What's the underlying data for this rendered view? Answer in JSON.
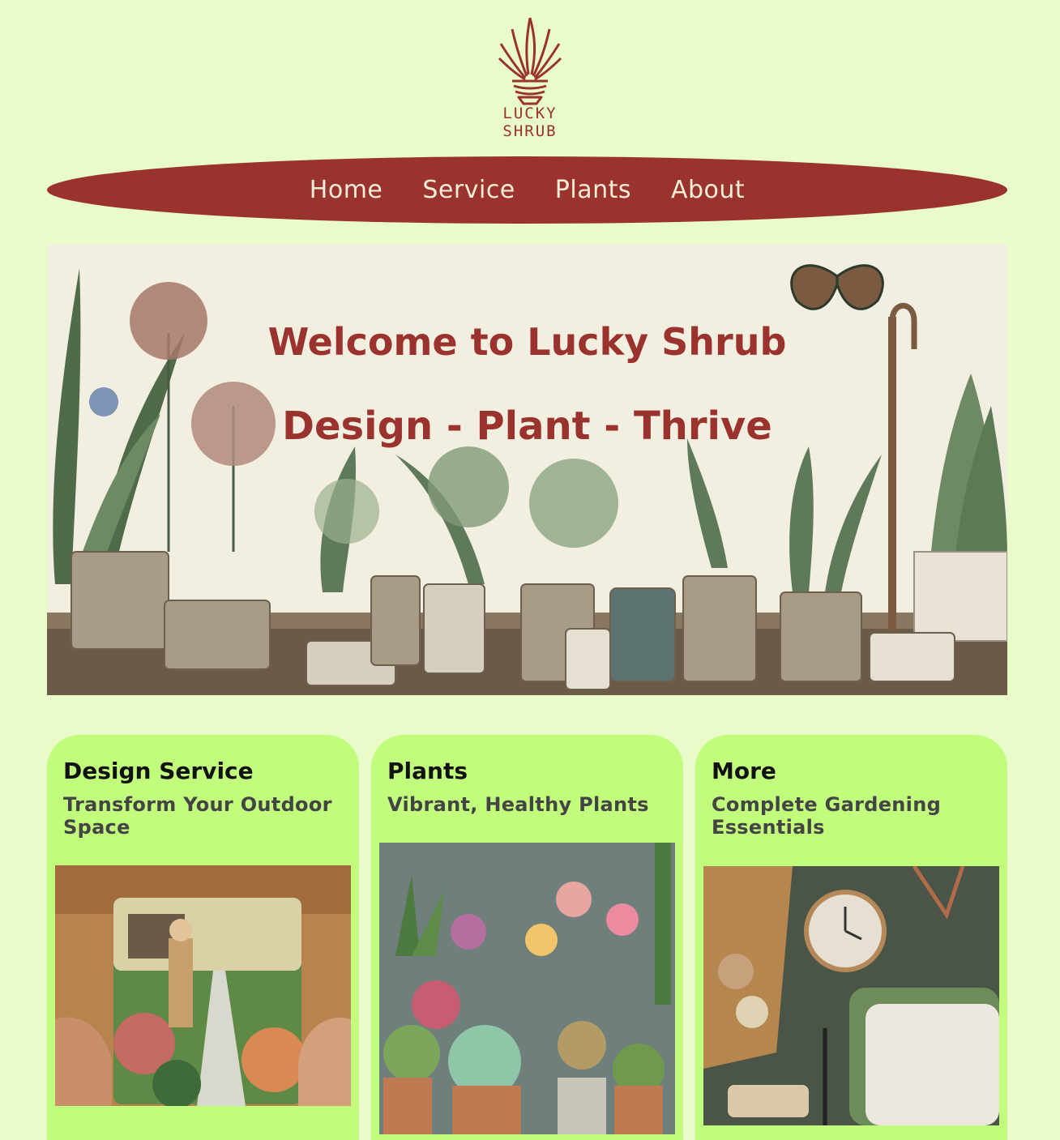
{
  "brand": {
    "name_line1": "LUCKY",
    "name_line2": "SHRUB",
    "accent_color": "#9a332e"
  },
  "nav": {
    "items": [
      "Home",
      "Service",
      "Plants",
      "About"
    ]
  },
  "hero": {
    "title": "Welcome to Lucky Shrub",
    "subtitle": "Design - Plant - Thrive"
  },
  "cards": [
    {
      "title": "Design Service",
      "subtitle": "Transform Your Outdoor Space",
      "image": "garden-design-photo"
    },
    {
      "title": "Plants",
      "subtitle": "Vibrant, Healthy Plants",
      "image": "potted-plants-photo"
    },
    {
      "title": "More",
      "subtitle": "Complete Gardening Essentials",
      "image": "gardening-tools-photo"
    }
  ]
}
